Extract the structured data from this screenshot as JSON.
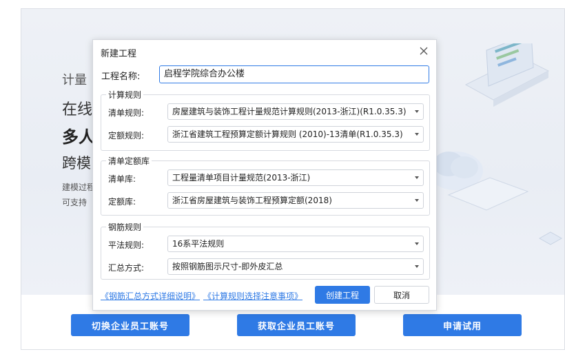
{
  "background": {
    "headline_lines": [
      "计量",
      "在线",
      "多人",
      "跨模",
      "建模过程",
      "可支持"
    ],
    "buttons": {
      "switch_account": "切换企业员工账号",
      "get_account": "获取企业员工账号",
      "apply_trial": "申请试用"
    },
    "accent_color": "#2f7ae5"
  },
  "dialog": {
    "title": "新建工程",
    "close_icon": "close-icon",
    "project_name_label": "工程名称:",
    "project_name_value": "启程学院综合办公楼",
    "calc_rules": {
      "title": "计算规则",
      "bill_rule_label": "清单规则:",
      "bill_rule_value": "房屋建筑与装饰工程计量规范计算规则(2013-浙江)(R1.0.35.3)",
      "quota_rule_label": "定额规则:",
      "quota_rule_value": "浙江省建筑工程预算定额计算规则 (2010)-13清单(R1.0.35.3)"
    },
    "bill_quota_lib": {
      "title": "清单定额库",
      "bill_lib_label": "清单库:",
      "bill_lib_value": "工程量清单项目计量规范(2013-浙江)",
      "quota_lib_label": "定额库:",
      "quota_lib_value": "浙江省房屋建筑与装饰工程预算定额(2018)"
    },
    "rebar_rules": {
      "title": "钢筋规则",
      "flat_rule_label": "平法规则:",
      "flat_rule_value": "16系平法规则",
      "summary_label": "汇总方式:",
      "summary_value": "按照钢筋图示尺寸-即外皮汇总"
    },
    "links": {
      "rebar_summary_help": "《钢筋汇总方式详细说明》",
      "rule_selection_notes": "《计算规则选择注意事项》"
    },
    "buttons": {
      "create": "创建工程",
      "cancel": "取消"
    }
  }
}
